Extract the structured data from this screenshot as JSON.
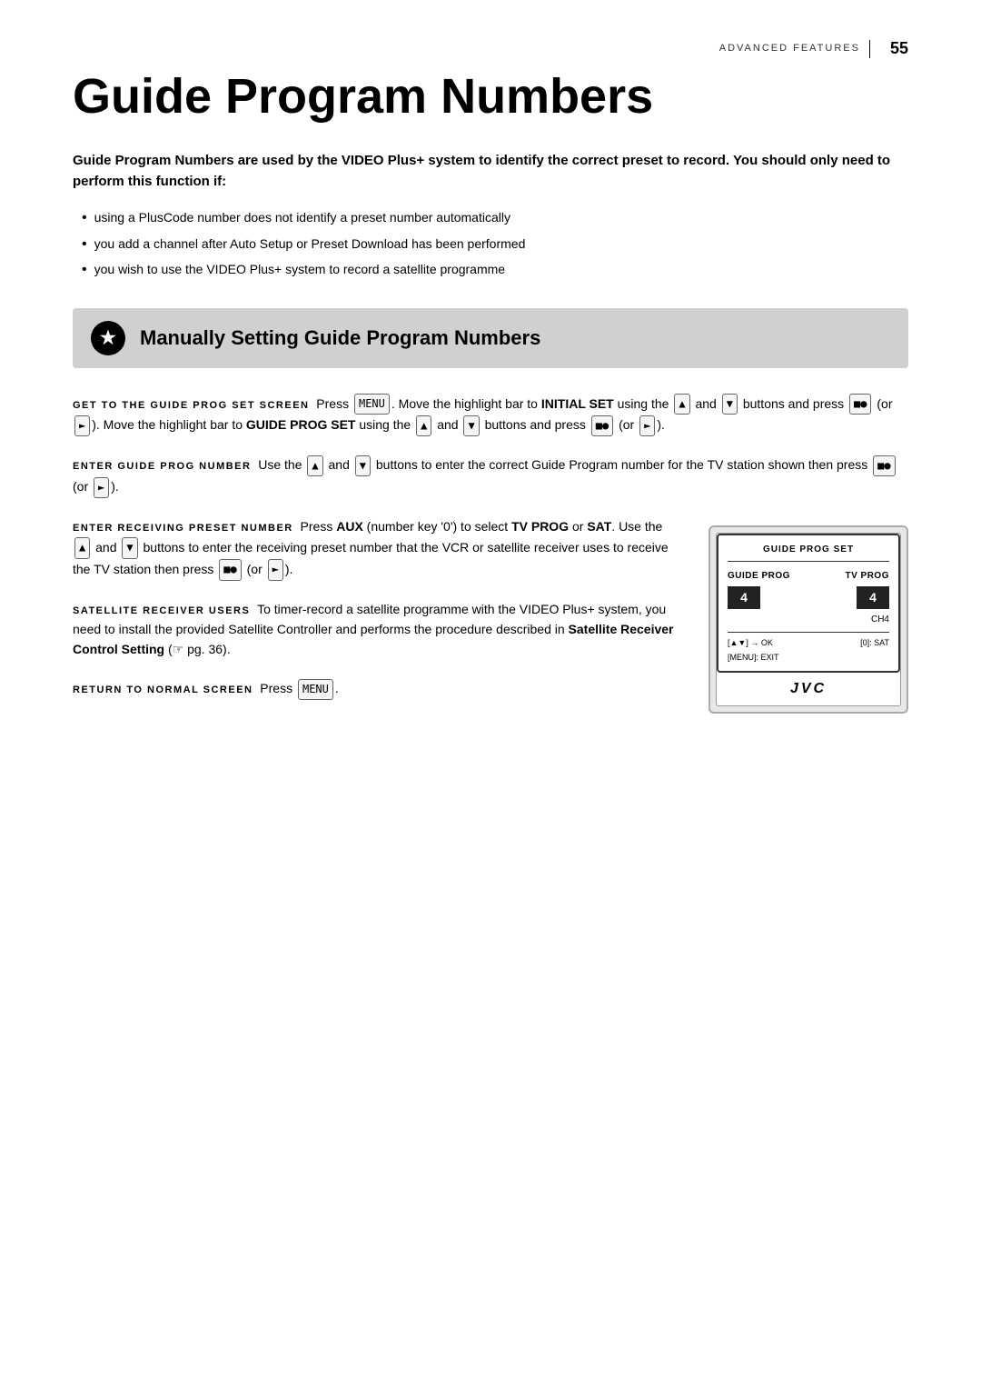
{
  "header": {
    "section_label": "ADVANCED FEATURES",
    "page_number": "55"
  },
  "title": "Guide Program Numbers",
  "intro": {
    "bold_text": "Guide Program Numbers are used by the VIDEO Plus+ system to identify the correct preset to record. You should only need to perform this function if:",
    "bullets": [
      "using a PlusCode number does not identify a preset number automatically",
      "you add a channel after Auto Setup or Preset Download has been performed",
      "you wish to use the VIDEO Plus+ system to record a satellite programme"
    ]
  },
  "section": {
    "title": "Manually Setting Guide Program Numbers",
    "icon": "★"
  },
  "steps": [
    {
      "id": "step1",
      "label": "GET TO THE GUIDE PROG SET SCREEN",
      "text": "Press [MENU]. Move the highlight bar to INITIAL SET using the [▲] and [▼] buttons and press [SELECT] (or [►]). Move the highlight bar to GUIDE PROG SET using the [▲] and [▼] buttons and press [SELECT] (or [►])."
    },
    {
      "id": "step2",
      "label": "ENTER GUIDE PROG NUMBER",
      "text": "Use the [▲] and [▼] buttons to enter the correct Guide Program number for the TV station shown then press [SELECT] (or [►])."
    },
    {
      "id": "step3",
      "label": "ENTER RECEIVING PRESET NUMBER",
      "text": "Press AUX (number key '0') to select TV PROG or SAT. Use the [▲] and [▼] buttons to enter the receiving preset number that the VCR or satellite receiver uses to receive the TV station then press [SELECT] (or [►])."
    },
    {
      "id": "step4",
      "label": "SATELLITE RECEIVER USERS",
      "text": "To timer-record a satellite programme with the VIDEO Plus+ system, you need to install the provided Satellite Controller and performs the procedure described in Satellite Receiver Control Setting (☞ pg. 36)."
    },
    {
      "id": "step5",
      "label": "RETURN TO NORMAL SCREEN",
      "text": "Press [MENU]."
    }
  ],
  "screen_diagram": {
    "title": "GUIDE PROG SET",
    "col1_label": "GUIDE PROG",
    "col2_label": "TV PROG",
    "col1_value": "4",
    "col2_value": "4",
    "ch4_label": "CH4",
    "footer_left": "[▲▼] → OK",
    "footer_mid": "[MENU]: EXIT",
    "footer_right": "[0]: SAT",
    "brand": "JVC"
  }
}
